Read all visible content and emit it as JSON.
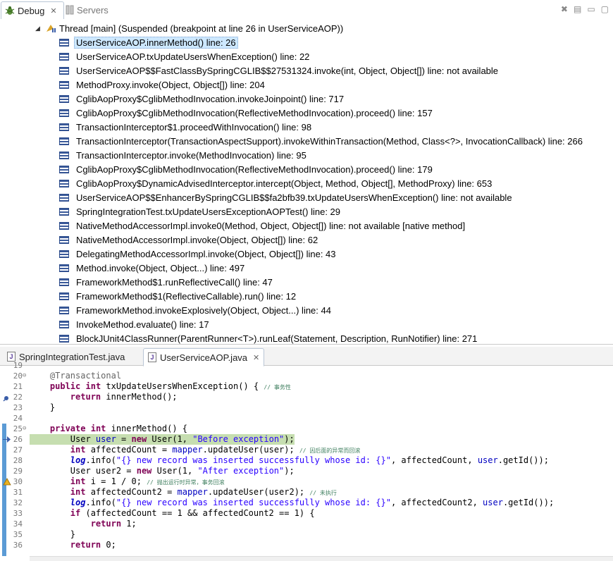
{
  "debug_tabs": [
    {
      "label": "Debug",
      "active": true
    },
    {
      "label": "Servers",
      "active": false
    }
  ],
  "thread": "Thread [main] (Suspended (breakpoint at line 26 in UserServiceAOP))",
  "frames": [
    "UserServiceAOP.innerMethod() line: 26",
    "UserServiceAOP.txUpdateUsersWhenException() line: 22",
    "UserServiceAOP$$FastClassBySpringCGLIB$$27531324.invoke(int, Object, Object[]) line: not available",
    "MethodProxy.invoke(Object, Object[]) line: 204",
    "CglibAopProxy$CglibMethodInvocation.invokeJoinpoint() line: 717",
    "CglibAopProxy$CglibMethodInvocation(ReflectiveMethodInvocation).proceed() line: 157",
    "TransactionInterceptor$1.proceedWithInvocation() line: 98",
    "TransactionInterceptor(TransactionAspectSupport).invokeWithinTransaction(Method, Class<?>, InvocationCallback) line: 266",
    "TransactionInterceptor.invoke(MethodInvocation) line: 95",
    "CglibAopProxy$CglibMethodInvocation(ReflectiveMethodInvocation).proceed() line: 179",
    "CglibAopProxy$DynamicAdvisedInterceptor.intercept(Object, Method, Object[], MethodProxy) line: 653",
    "UserServiceAOP$$EnhancerBySpringCGLIB$$fa2bfb39.txUpdateUsersWhenException() line: not available",
    "SpringIntegrationTest.txUpdateUsersExceptionAOPTest() line: 29",
    "NativeMethodAccessorImpl.invoke0(Method, Object, Object[]) line: not available [native method]",
    "NativeMethodAccessorImpl.invoke(Object, Object[]) line: 62",
    "DelegatingMethodAccessorImpl.invoke(Object, Object[]) line: 43",
    "Method.invoke(Object, Object...) line: 497",
    "FrameworkMethod$1.runReflectiveCall() line: 47",
    "FrameworkMethod$1(ReflectiveCallable).run() line: 12",
    "FrameworkMethod.invokeExplosively(Object, Object...) line: 44",
    "InvokeMethod.evaluate() line: 17",
    "BlockJUnit4ClassRunner(ParentRunner<T>).runLeaf(Statement, Description, RunNotifier) line: 271"
  ],
  "editor_tabs": [
    {
      "label": "SpringIntegrationTest.java",
      "active": false
    },
    {
      "label": "UserServiceAOP.java",
      "active": true
    }
  ],
  "code": [
    {
      "n": "19",
      "html": ""
    },
    {
      "n": "20",
      "html": "    <span class='ann'>@Transactional</span>"
    },
    {
      "n": "21",
      "html": "    <span class='kw'>public</span> <span class='kw'>int</span> txUpdateUsersWhenException() { <span class='cmt'>// 事务性</span>"
    },
    {
      "n": "22",
      "html": "        <span class='kw'>return</span> innerMethod();"
    },
    {
      "n": "23",
      "html": "    }"
    },
    {
      "n": "24",
      "html": ""
    },
    {
      "n": "25",
      "html": "    <span class='kw'>private</span> <span class='kw'>int</span> innerMethod() {"
    },
    {
      "n": "26",
      "html": "        User <span class='fld'>user</span> = <span class='kw'>new</span> User(1, <span class='str'>\"Before exception\"</span>);"
    },
    {
      "n": "27",
      "html": "        <span class='kw'>int</span> affectedCount = <span class='fld'>mapper</span>.updateUser(user); <span class='cmt'>// 因后面的异常而回滚</span>"
    },
    {
      "n": "28",
      "html": "        <span class='it'>log</span>.info(<span class='str'>\"{} new record was inserted successfully whose id: {}\"</span>, affectedCount, <span class='fld'>user</span>.getId());"
    },
    {
      "n": "29",
      "html": "        User user2 = <span class='kw'>new</span> User(1, <span class='str'>\"After exception\"</span>);"
    },
    {
      "n": "30",
      "html": "        <span class='kw'>int</span> i = 1 / 0; <span class='cmt'>// 抛出运行时异常，事务回滚</span>"
    },
    {
      "n": "31",
      "html": "        <span class='kw'>int</span> affectedCount2 = <span class='fld'>mapper</span>.updateUser(user2); <span class='cmt'>// 未执行</span>"
    },
    {
      "n": "32",
      "html": "        <span class='it'>log</span>.info(<span class='str'>\"{} new record was inserted successfully whose id: {}\"</span>, affectedCount2, <span class='fld'>user</span>.getId());"
    },
    {
      "n": "33",
      "html": "        <span class='kw'>if</span> (affectedCount == 1 &amp;&amp; affectedCount2 == 1) {"
    },
    {
      "n": "34",
      "html": "            <span class='kw'>return</span> 1;"
    },
    {
      "n": "35",
      "html": "        }"
    },
    {
      "n": "36",
      "html": "        <span class='kw'>return</span> 0;"
    }
  ]
}
